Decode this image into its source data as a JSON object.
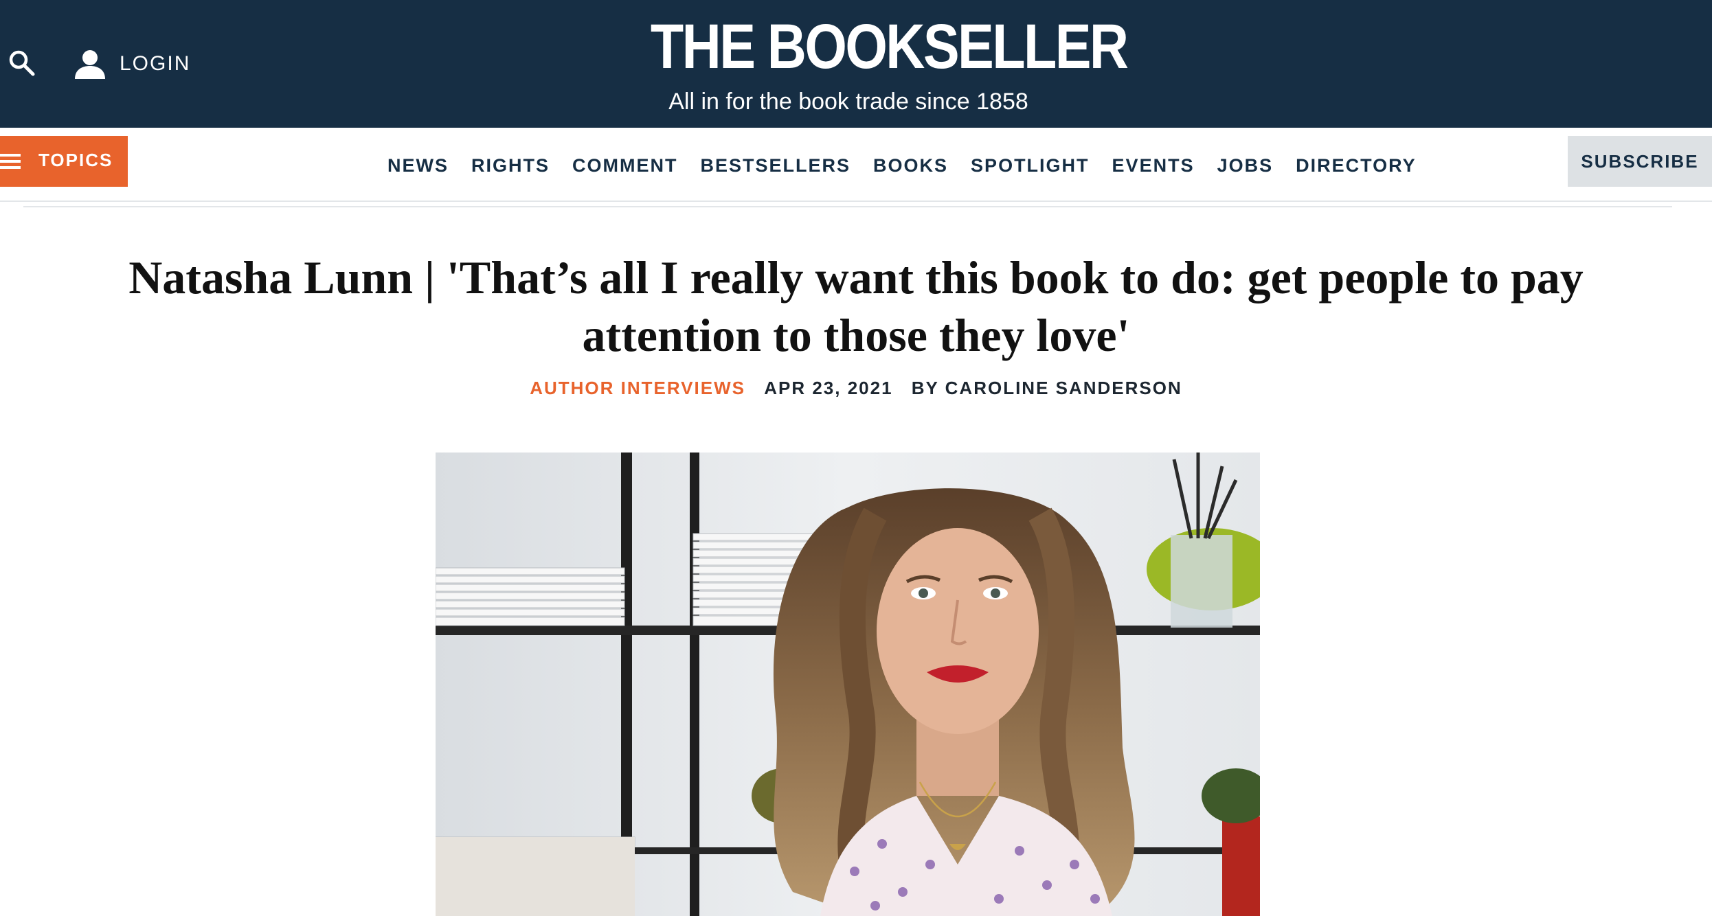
{
  "header": {
    "logo_title": "THE BOOKSELLER",
    "logo_tagline": "All in for the book trade since 1858",
    "login_label": "LOGIN",
    "background_color": "#162e44",
    "icons": [
      "search-icon",
      "user-icon"
    ]
  },
  "nav": {
    "topics_label": "TOPICS",
    "topics_color": "#e8632c",
    "items": [
      {
        "label": "NEWS"
      },
      {
        "label": "RIGHTS"
      },
      {
        "label": "COMMENT"
      },
      {
        "label": "BESTSELLERS"
      },
      {
        "label": "BOOKS"
      },
      {
        "label": "SPOTLIGHT"
      },
      {
        "label": "EVENTS"
      },
      {
        "label": "JOBS"
      },
      {
        "label": "DIRECTORY"
      }
    ],
    "subscribe_label": "SUBSCRIBE"
  },
  "article": {
    "headline_line1": "Natasha Lunn | 'That’s all I really want this book to do: get people to pay",
    "headline_line2": "attention to those they love'",
    "category": "AUTHOR INTERVIEWS",
    "date": "APR 23, 2021",
    "byline": "BY CAROLINE SANDERSON"
  }
}
